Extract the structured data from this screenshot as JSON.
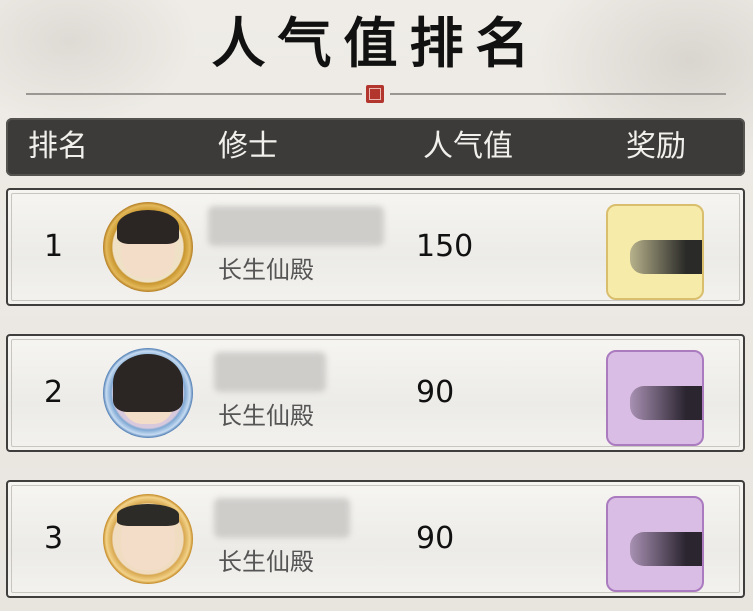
{
  "title": "人气值排名",
  "header": {
    "rank": "排名",
    "name": "修士",
    "popularity": "人气值",
    "reward": "奖励"
  },
  "rows": [
    {
      "rank": "1",
      "guild": "长生仙殿",
      "popularity": "150",
      "reward_tier": "gold"
    },
    {
      "rank": "2",
      "guild": "长生仙殿",
      "popularity": "90",
      "reward_tier": "purple"
    },
    {
      "rank": "3",
      "guild": "长生仙殿",
      "popularity": "90",
      "reward_tier": "purple"
    }
  ],
  "colors": {
    "header_bg": "#3c3b39",
    "gold_reward": "#f6eba9",
    "purple_reward": "#d9bde4",
    "seal": "#b3362e"
  }
}
